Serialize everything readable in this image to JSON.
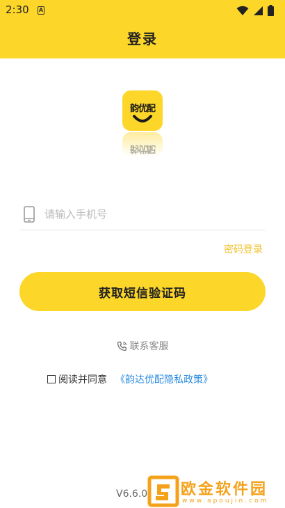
{
  "status_bar": {
    "time": "2:30",
    "notification_glyph": "A",
    "icons": [
      "wifi-icon",
      "signal-icon",
      "battery-icon"
    ]
  },
  "header": {
    "title": "登录",
    "background": "#fcd629"
  },
  "logo": {
    "text": "韵优配"
  },
  "phone_field": {
    "value": "",
    "placeholder": "请输入手机号",
    "icon": "phone-icon"
  },
  "password_login_label": "密码登录",
  "sms_button_label": "获取短信验证码",
  "customer_service": {
    "icon": "phone-call-icon",
    "label": "联系客服"
  },
  "agreement": {
    "checked": false,
    "label": "阅读并同意",
    "policy_link": "《韵达优配隐私政策》"
  },
  "version": "V6.6.0 Pro",
  "watermark": {
    "title": "欧金软件园",
    "url": "www.apoujin.com"
  },
  "colors": {
    "accent": "#fcd629",
    "link_gold": "#f2c12e",
    "link_blue": "#2a8be0",
    "watermark": "#f5a21b"
  }
}
